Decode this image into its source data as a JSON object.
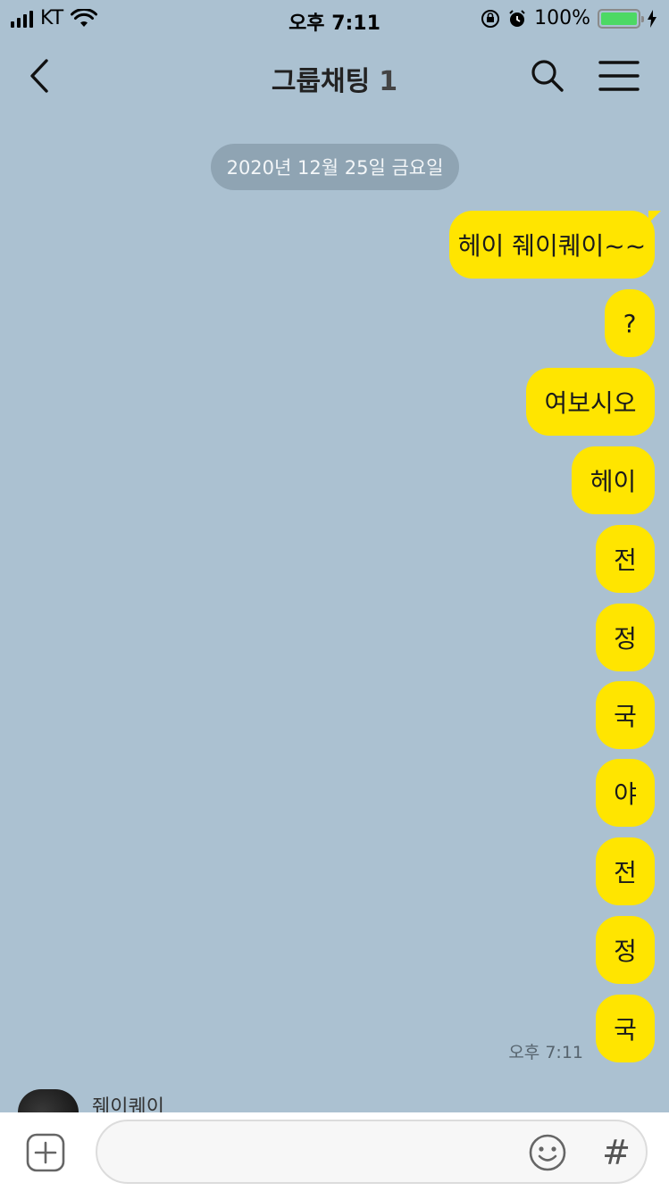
{
  "status_bar": {
    "carrier": "KT",
    "time": "오후 7:11",
    "battery_percent": "100%",
    "battery_level": 1.0,
    "battery_color": "#4cd964"
  },
  "header": {
    "back_icon": "chevron-left-icon",
    "title": "그룹채팅",
    "member_count": "1",
    "search_icon": "search-icon",
    "menu_icon": "hamburger-menu-icon"
  },
  "date_divider": "2020년 12월 25일 금요일",
  "messages": [
    {
      "text": "헤이 줴이퀘이~~"
    },
    {
      "text": "?"
    },
    {
      "text": "여보시오"
    },
    {
      "text": "헤이"
    },
    {
      "text": "전"
    },
    {
      "text": "정"
    },
    {
      "text": "국"
    },
    {
      "text": "야"
    },
    {
      "text": "전"
    },
    {
      "text": "정"
    },
    {
      "text": "국"
    }
  ],
  "last_message_time": "오후 7:11",
  "other_user": {
    "name": "줴이퀘이"
  },
  "input_bar": {
    "plus_icon": "plus-square-icon",
    "placeholder": "",
    "emoji_icon": "emoji-icon",
    "hash_label": "#"
  },
  "colors": {
    "background": "#abc1d1",
    "my_bubble": "#ffe500"
  }
}
